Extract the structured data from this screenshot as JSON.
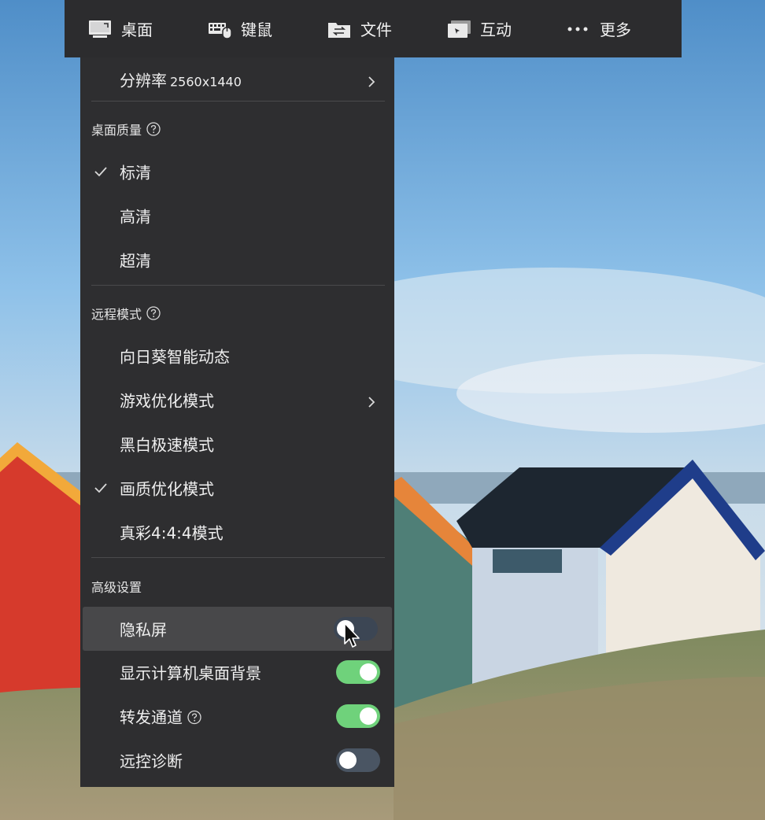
{
  "toolbar": {
    "items": [
      {
        "label": "桌面",
        "icon": "monitor-icon"
      },
      {
        "label": "键鼠",
        "icon": "keyboard-mouse-icon"
      },
      {
        "label": "文件",
        "icon": "folder-transfer-icon"
      },
      {
        "label": "互动",
        "icon": "interaction-icon"
      },
      {
        "label": "更多",
        "icon": "more-dots-icon"
      }
    ]
  },
  "menu": {
    "resolution": {
      "label": "分辨率",
      "value": "2560x1440"
    },
    "quality": {
      "title": "桌面质量",
      "options": [
        {
          "label": "标清",
          "selected": true
        },
        {
          "label": "高清",
          "selected": false
        },
        {
          "label": "超清",
          "selected": false
        }
      ]
    },
    "remote_mode": {
      "title": "远程模式",
      "options": [
        {
          "label": "向日葵智能动态",
          "selected": false
        },
        {
          "label": "游戏优化模式",
          "selected": false,
          "submenu": true
        },
        {
          "label": "黑白极速模式",
          "selected": false
        },
        {
          "label": "画质优化模式",
          "selected": true
        },
        {
          "label": "真彩4:4:4模式",
          "selected": false
        }
      ]
    },
    "advanced": {
      "title": "高级设置",
      "toggles": [
        {
          "label": "隐私屏",
          "on": false
        },
        {
          "label": "显示计算机桌面背景",
          "on": true
        },
        {
          "label": "转发通道",
          "on": true
        },
        {
          "label": "远控诊断",
          "on": false
        }
      ]
    }
  },
  "colors": {
    "toolbar_bg": "#2c2c2e",
    "menu_bg": "#2e2e30",
    "toggle_on": "#6fd27b",
    "toggle_off": "#4a5563"
  }
}
